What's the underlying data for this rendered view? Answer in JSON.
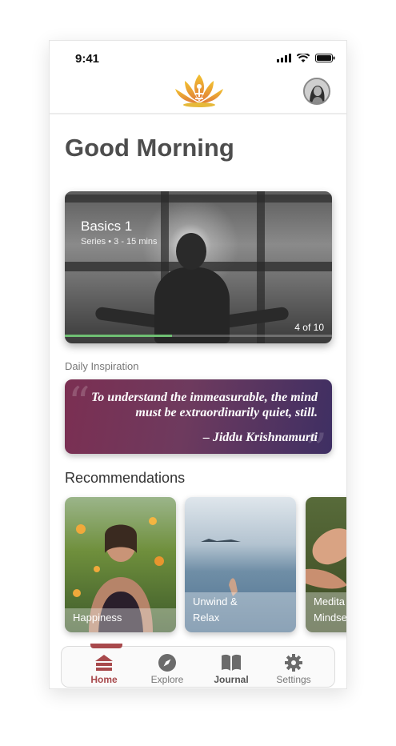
{
  "status_bar": {
    "time": "9:41"
  },
  "header": {
    "logo": "lotus-meditation-logo",
    "avatar": "user-avatar"
  },
  "greeting": "Good Morning",
  "featured": {
    "title": "Basics 1",
    "subtitle": "Series • 3 - 15 mins",
    "progress_text": "4 of 10",
    "progress_fraction": 0.4
  },
  "daily_inspiration": {
    "label": "Daily Inspiration",
    "quote": "To understand the immeasurable, the mind must be extraordinarily quiet, still.",
    "author": "– Jiddu Krishnamurti"
  },
  "recommendations": {
    "title": "Recommendations",
    "items": [
      {
        "label": "Happiness"
      },
      {
        "label": "Unwind &\nRelax"
      },
      {
        "label": "Medita\nMindse"
      }
    ]
  },
  "tabbar": {
    "tabs": [
      {
        "label": "Home",
        "icon": "home-icon",
        "active": true
      },
      {
        "label": "Explore",
        "icon": "compass-icon"
      },
      {
        "label": "Journal",
        "icon": "book-icon"
      },
      {
        "label": "Settings",
        "icon": "gear-icon"
      }
    ]
  },
  "colors": {
    "accent": "#a8494c",
    "progress": "#6fbf73",
    "logo_gold": "#e0b53a"
  }
}
